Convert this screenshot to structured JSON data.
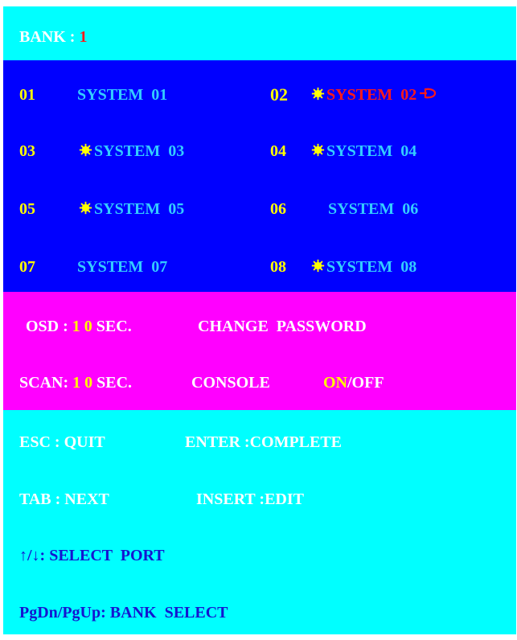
{
  "bank": {
    "label": "BANK : ",
    "number": "1"
  },
  "ports": [
    {
      "num": "01",
      "name": "SYSTEM  01",
      "active": false,
      "selected": false
    },
    {
      "num": "02",
      "name": "SYSTEM  02",
      "active": true,
      "selected": true
    },
    {
      "num": "03",
      "name": "SYSTEM  03",
      "active": true,
      "selected": false
    },
    {
      "num": "04",
      "name": "SYSTEM  04",
      "active": true,
      "selected": false
    },
    {
      "num": "05",
      "name": "SYSTEM  05",
      "active": true,
      "selected": false
    },
    {
      "num": "06",
      "name": "SYSTEM  06",
      "active": false,
      "selected": false
    },
    {
      "num": "07",
      "name": "SYSTEM  07",
      "active": false,
      "selected": false
    },
    {
      "num": "08",
      "name": "SYSTEM  08",
      "active": true,
      "selected": false
    }
  ],
  "settings": {
    "osd_label": "OSD : ",
    "osd_d1": "1",
    "osd_d2": "0",
    "osd_unit": "SEC.",
    "change_password": "CHANGE  PASSWORD",
    "scan_label": "SCAN: ",
    "scan_d1": "1",
    "scan_d2": "0",
    "scan_unit": "SEC.",
    "console_label": "CONSOLE",
    "console_on": "ON",
    "console_off": "/OFF"
  },
  "help": {
    "esc": "ESC : QUIT",
    "enter": "ENTER :COMPLETE",
    "tab": "TAB : NEXT",
    "insert": "INSERT :EDIT",
    "arrows": "↑/↓: SELECT  PORT",
    "pgdn": "PgDn/PgUp: BANK  SELECT"
  },
  "colors": {
    "cyan": "#00ffff",
    "blue": "#0000ff",
    "magenta": "#ff00ff",
    "yellow": "#ffff00",
    "red": "#ff1a1a",
    "light_blue": "#33ccff"
  },
  "icons": {
    "active_marker": "sun-icon",
    "selection_pointer": "pointing-hand-icon"
  }
}
